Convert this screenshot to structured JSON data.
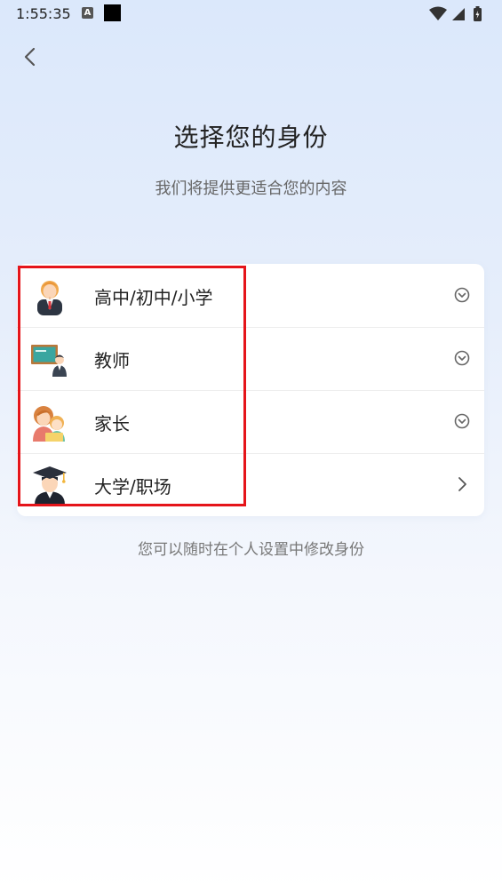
{
  "status_bar": {
    "time": "1:55:35",
    "notif_letter": "A"
  },
  "page": {
    "title": "选择您的身份",
    "subtitle": "我们将提供更适合您的内容",
    "footnote": "您可以随时在个人设置中修改身份"
  },
  "identities": [
    {
      "label": "高中/初中/小学",
      "icon": "student-icon",
      "chevron": "expand-circle-icon"
    },
    {
      "label": "教师",
      "icon": "teacher-icon",
      "chevron": "expand-circle-icon"
    },
    {
      "label": "家长",
      "icon": "parent-icon",
      "chevron": "expand-circle-icon"
    },
    {
      "label": "大学/职场",
      "icon": "graduate-icon",
      "chevron": "chevron-right-icon"
    }
  ],
  "colors": {
    "highlight": "#e5141a",
    "background_top": "#dbe8fb"
  }
}
